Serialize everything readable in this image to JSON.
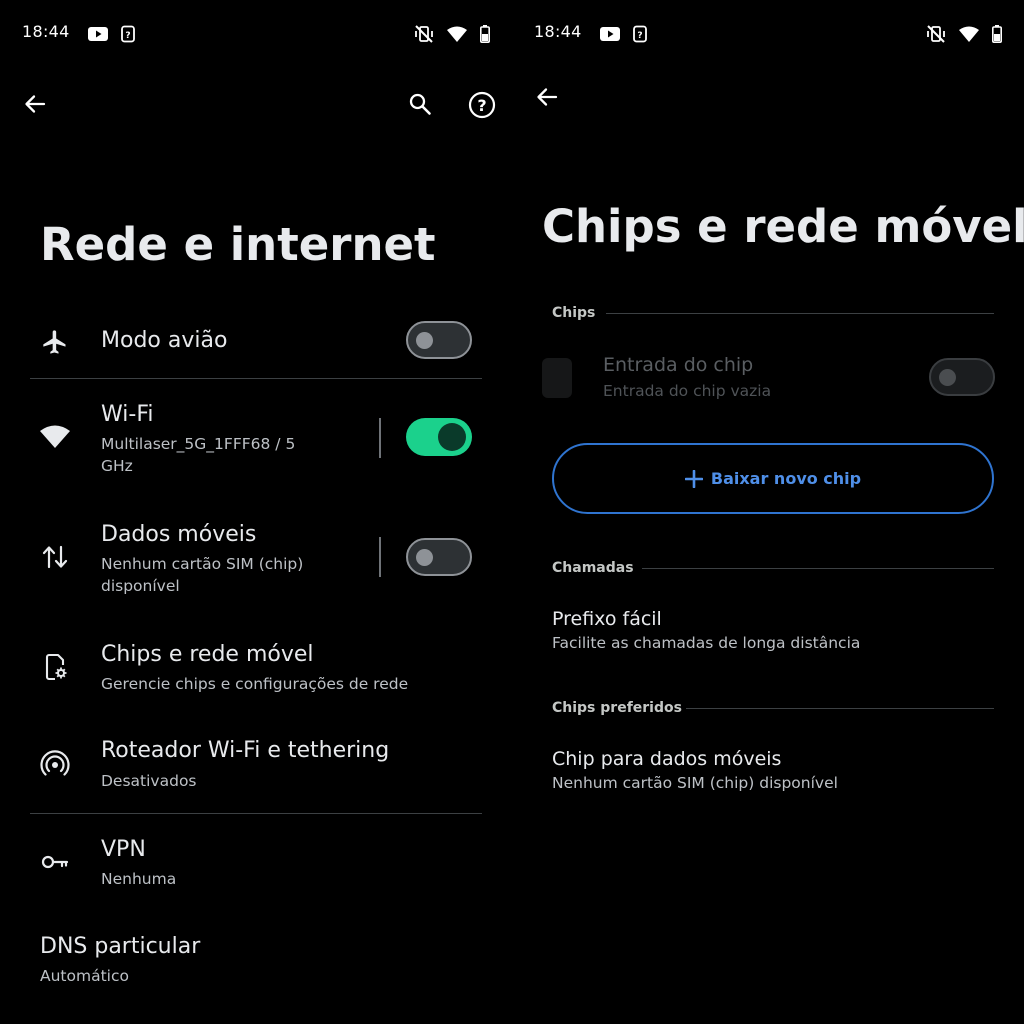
{
  "status_bar": {
    "time": "18:44"
  },
  "left": {
    "title": "Rede e internet",
    "items": [
      {
        "id": "modo-aviao",
        "title": "Modo avião",
        "icon": "airplane-icon",
        "toggle": "off"
      },
      {
        "id": "wifi",
        "title": "Wi-Fi",
        "subtitle_line1": "Multilaser_5G_1FFF68 / 5",
        "subtitle_line2": "GHz",
        "icon": "wifi-icon",
        "toggle": "on"
      },
      {
        "id": "dados-moveis",
        "title": "Dados móveis",
        "subtitle_line1": "Nenhum cartão SIM (chip)",
        "subtitle_line2": "disponível",
        "icon": "mobile-data-icon",
        "toggle": "off"
      },
      {
        "id": "chips",
        "title": "Chips e rede móvel",
        "subtitle": "Gerencie chips e configurações de rede",
        "icon": "sim-settings-icon"
      },
      {
        "id": "roteador",
        "title": "Roteador Wi-Fi e tethering",
        "subtitle": "Desativados",
        "icon": "hotspot-icon"
      },
      {
        "id": "vpn",
        "title": "VPN",
        "subtitle": "Nenhuma",
        "icon": "key-icon"
      },
      {
        "id": "dns",
        "title": "DNS particular",
        "subtitle": "Automático"
      }
    ]
  },
  "right": {
    "title": "Chips e rede móvel",
    "section_chips": "Chips",
    "sim_entry": {
      "title": "Entrada do chip",
      "subtitle": "Entrada do chip vazia",
      "toggle": "disabled"
    },
    "download_button": {
      "label": "Baixar novo chip"
    },
    "section_calls": "Chamadas",
    "prefix": {
      "title": "Prefixo fácil",
      "subtitle": "Facilite as chamadas de longa distância"
    },
    "section_preferred": "Chips preferidos",
    "data_chip": {
      "title": "Chip para dados móveis",
      "subtitle": "Nenhum cartão SIM (chip) disponível"
    }
  },
  "colors": {
    "background": "#000000",
    "switch_on": "#1bd18c",
    "accent_blue": "#4f8fe8",
    "text_primary": "#e8eaed",
    "text_secondary": "#bdc1c6"
  }
}
